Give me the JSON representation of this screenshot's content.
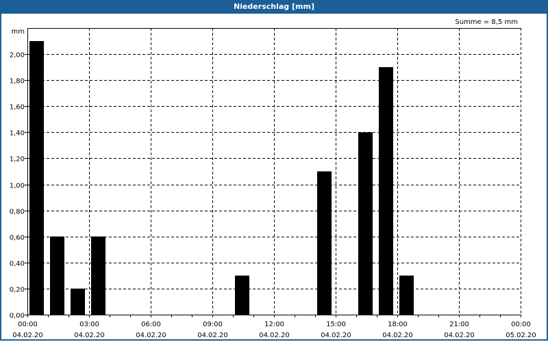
{
  "chart_data": {
    "type": "bar",
    "title": "Niederschlag [mm]",
    "annotation": "Summe = 8,5 mm",
    "ylabel": "mm",
    "ylim": [
      0,
      2.2
    ],
    "yticks": [
      "0,00",
      "0,20",
      "0,40",
      "0,60",
      "0,80",
      "1,00",
      "1,20",
      "1,40",
      "1,60",
      "1,80",
      "2,00"
    ],
    "xlim_hours": [
      0,
      24
    ],
    "xticks": [
      {
        "time": "00:00",
        "date": "04.02.20"
      },
      {
        "time": "03:00",
        "date": "04.02.20"
      },
      {
        "time": "06:00",
        "date": "04.02.20"
      },
      {
        "time": "09:00",
        "date": "04.02.20"
      },
      {
        "time": "12:00",
        "date": "04.02.20"
      },
      {
        "time": "15:00",
        "date": "04.02.20"
      },
      {
        "time": "18:00",
        "date": "04.02.20"
      },
      {
        "time": "21:00",
        "date": "04.02.20"
      },
      {
        "time": "00:00",
        "date": "05.02.20"
      }
    ],
    "bars": [
      {
        "hour": 0,
        "value": 2.1
      },
      {
        "hour": 1,
        "value": 0.6
      },
      {
        "hour": 2,
        "value": 0.2
      },
      {
        "hour": 3,
        "value": 0.6
      },
      {
        "hour": 10,
        "value": 0.3
      },
      {
        "hour": 14,
        "value": 1.1
      },
      {
        "hour": 16,
        "value": 1.4
      },
      {
        "hour": 17,
        "value": 1.9
      },
      {
        "hour": 18,
        "value": 0.3
      }
    ],
    "grid": true,
    "bar_color": "#000000",
    "title_bar_color": "#1b5e98"
  }
}
